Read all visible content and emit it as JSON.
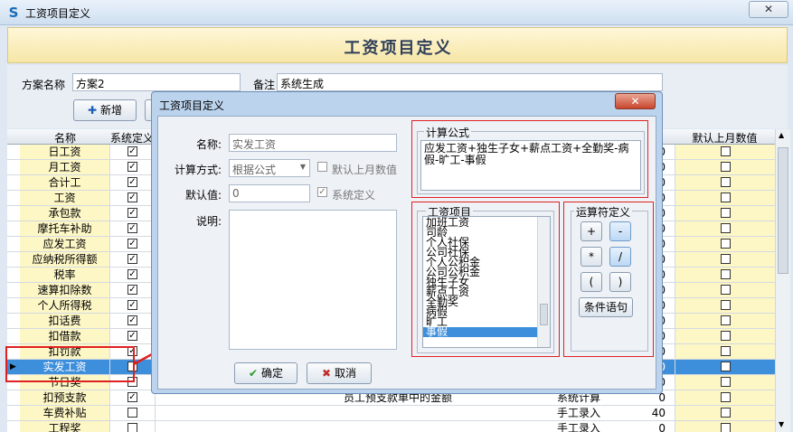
{
  "window": {
    "title": "工资项目定义",
    "close_label": "✕"
  },
  "header": {
    "title": "工资项目定义"
  },
  "plan": {
    "name_label": "方案名称",
    "name_value": "方案2",
    "remark_label": "备注",
    "remark_value": "系统生成"
  },
  "toolbar": {
    "add_label": "新增"
  },
  "grid": {
    "columns": [
      "名称",
      "系统定义",
      "默认上月数值"
    ],
    "rows": [
      {
        "name": "日工资",
        "sys": true,
        "desc": "",
        "source": "",
        "value": "0",
        "prev": false
      },
      {
        "name": "月工资",
        "sys": true,
        "desc": "",
        "source": "",
        "value": "0",
        "prev": false
      },
      {
        "name": "合计工",
        "sys": true,
        "desc": "",
        "source": "",
        "value": "0",
        "prev": false
      },
      {
        "name": "工资",
        "sys": true,
        "desc": "",
        "source": "",
        "value": "0",
        "prev": false
      },
      {
        "name": "承包款",
        "sys": true,
        "desc": "",
        "source": "",
        "value": "0",
        "prev": false
      },
      {
        "name": "摩托车补助",
        "sys": true,
        "desc": "",
        "source": "",
        "value": "0",
        "prev": false
      },
      {
        "name": "应发工资",
        "sys": true,
        "desc": "",
        "source": "",
        "value": "0",
        "prev": false
      },
      {
        "name": "应纳税所得额",
        "sys": true,
        "desc": "",
        "source": "",
        "value": "0",
        "prev": false
      },
      {
        "name": "税率",
        "sys": true,
        "desc": "",
        "source": "",
        "value": "0",
        "prev": false
      },
      {
        "name": "速算扣除数",
        "sys": true,
        "desc": "",
        "source": "",
        "value": "0",
        "prev": false
      },
      {
        "name": "个人所得税",
        "sys": true,
        "desc": "",
        "source": "",
        "value": "0",
        "prev": false
      },
      {
        "name": "扣话费",
        "sys": true,
        "desc": "",
        "source": "",
        "value": "0",
        "prev": false
      },
      {
        "name": "扣借款",
        "sys": true,
        "desc": "",
        "source": "",
        "value": "0",
        "prev": false
      },
      {
        "name": "扣罚款",
        "sys": true,
        "desc": "",
        "source": "",
        "value": "0",
        "prev": false
      },
      {
        "name": "实发工资",
        "sys": true,
        "desc": "",
        "source": "",
        "value": "0",
        "prev": false,
        "selected": true
      },
      {
        "name": "节日奖",
        "sys": false,
        "desc": "",
        "source": "",
        "value": "0",
        "prev": false
      },
      {
        "name": "扣预支款",
        "sys": true,
        "desc": "员工预支款单中的金额",
        "source": "系统计算",
        "value": "0",
        "prev": false
      },
      {
        "name": "车费补贴",
        "sys": false,
        "desc": "",
        "source": "手工录入",
        "value": "40",
        "prev": false
      },
      {
        "name": "工程奖",
        "sys": false,
        "desc": "",
        "source": "手工录入",
        "value": "0",
        "prev": false
      }
    ]
  },
  "dialog": {
    "title": "工资项目定义",
    "name_label": "名称:",
    "name_value": "实发工资",
    "calc_label": "计算方式:",
    "calc_value": "根据公式",
    "default_prev_label": "默认上月数值",
    "default_label": "默认值:",
    "default_value": "0",
    "sysdef_label": "系统定义",
    "desc_label": "说明:",
    "formula_title": "计算公式",
    "formula": "应发工资+独生子女+薪点工资+全勤奖-病假-旷工-事假",
    "items_title": "工资项目",
    "items": [
      "加班工资",
      "司龄",
      "个人社保",
      "公司社保",
      "个人公积金",
      "公司公积金",
      "独生子女",
      "薪点工资",
      "全勤奖",
      "病假",
      "旷工",
      "事假"
    ],
    "ops_title": "运算符定义",
    "ops": [
      "+",
      "-",
      "*",
      "/",
      "(",
      ")"
    ],
    "cond_label": "条件语句",
    "ok_label": "确定",
    "cancel_label": "取消"
  },
  "colors": {
    "accent": "#3d8fdc",
    "highlight": "#e02020",
    "header_band": "#f6e6a6"
  }
}
